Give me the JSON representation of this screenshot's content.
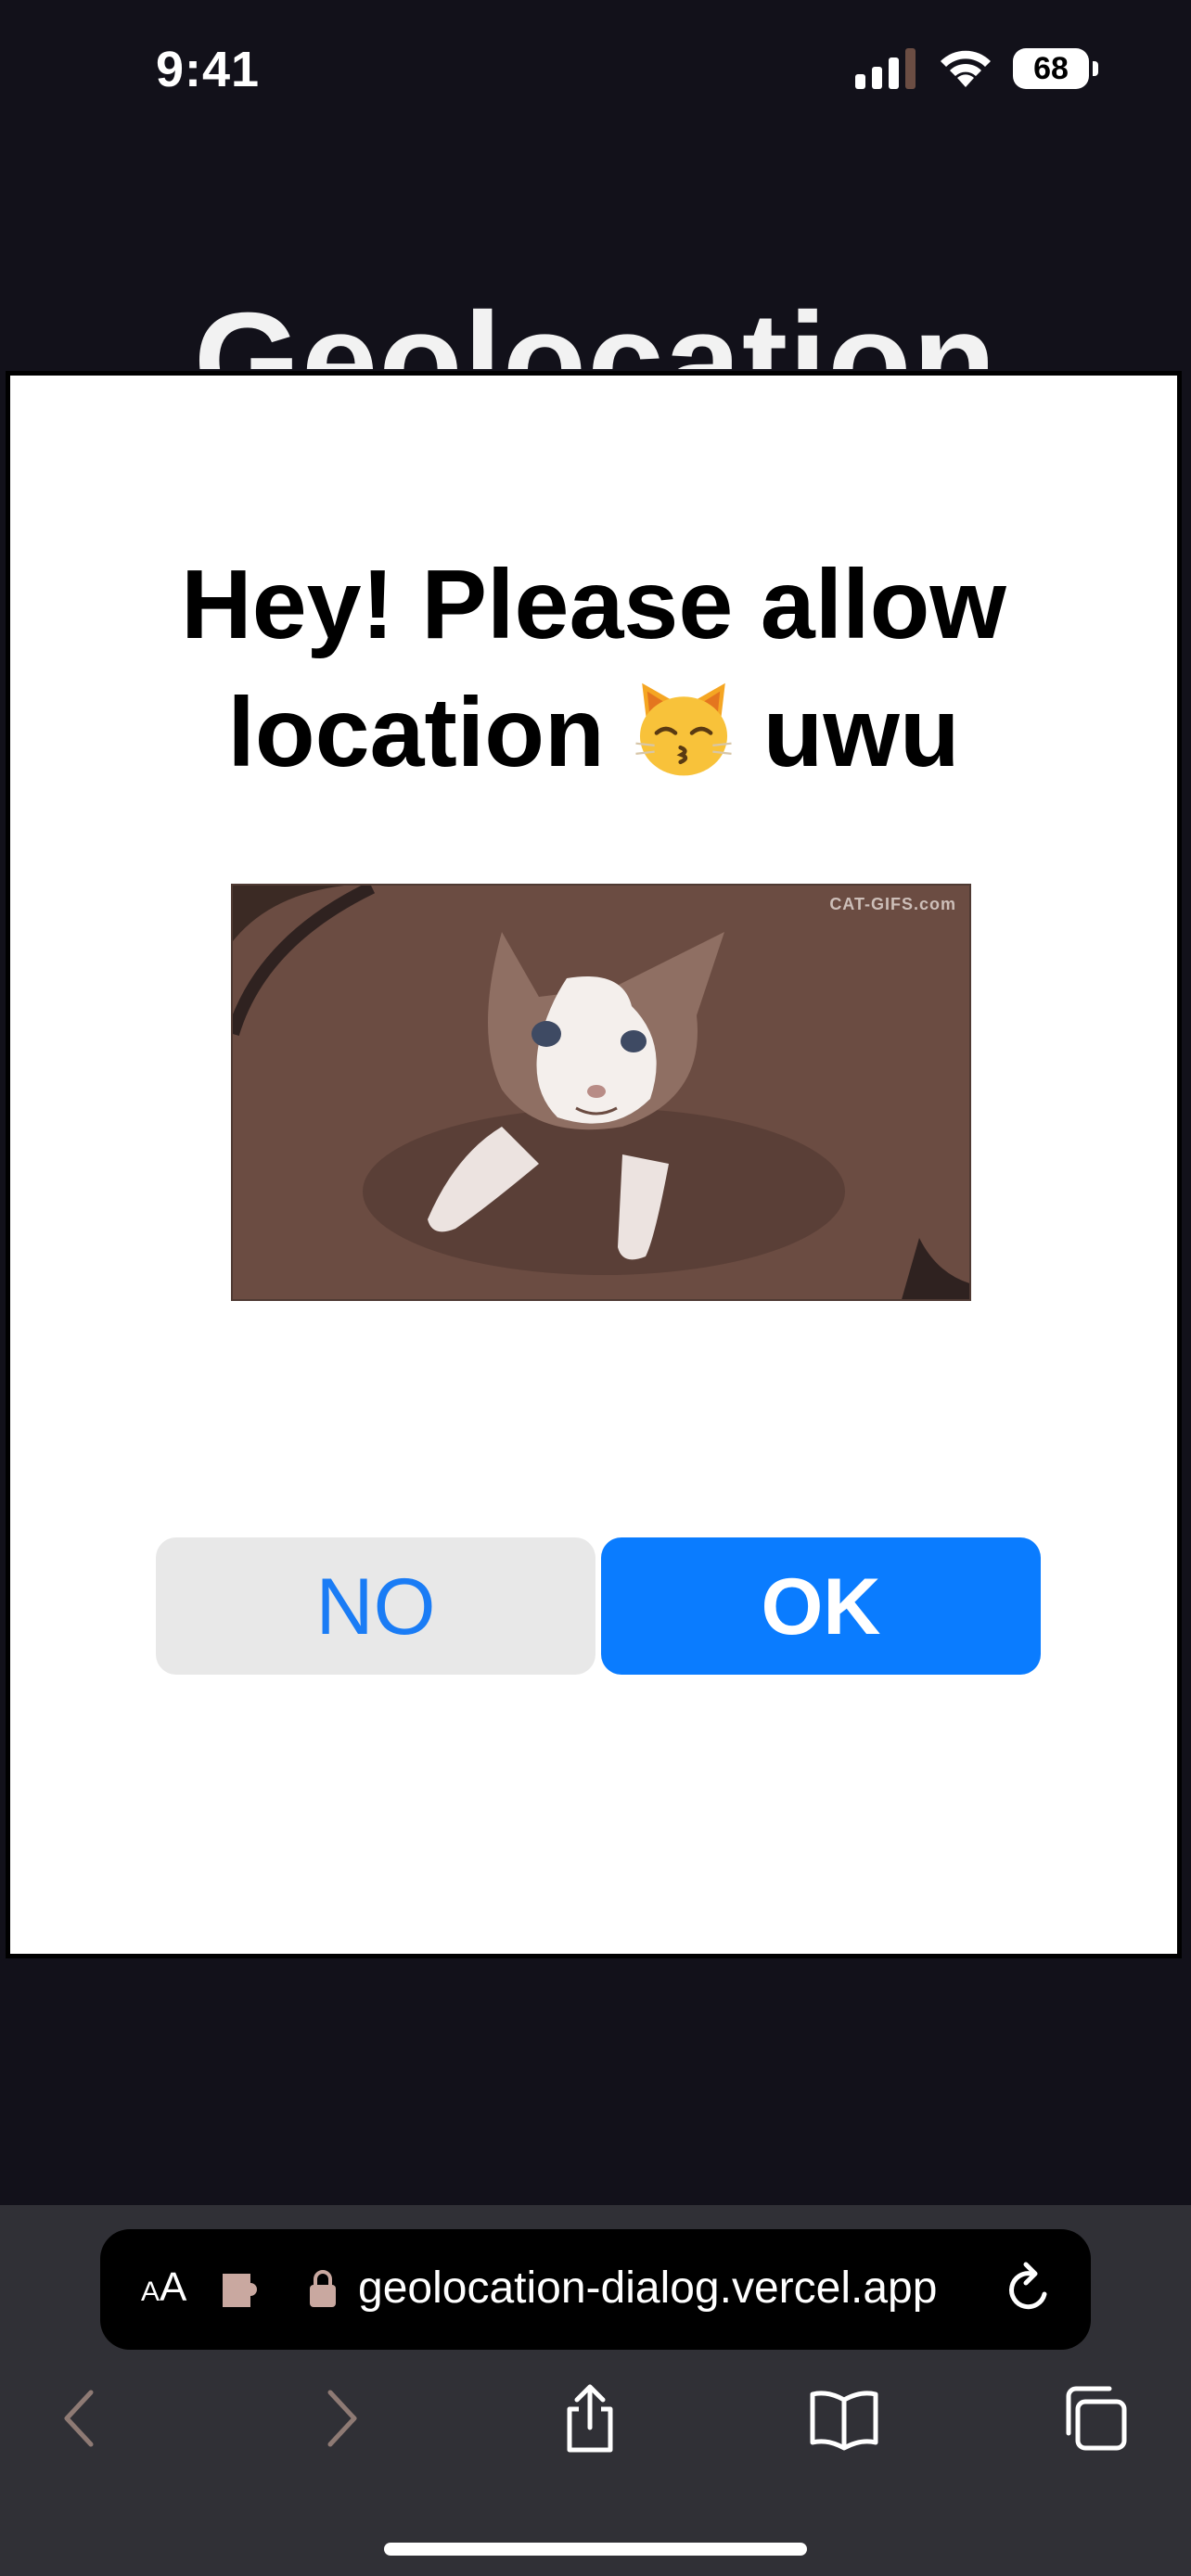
{
  "status_bar": {
    "time": "9:41",
    "battery": "68"
  },
  "background": {
    "heading": "Geolocation"
  },
  "dialog": {
    "title_line1": "Hey! Please allow",
    "title_line2_before": "location",
    "title_line2_after": "uwu",
    "title_emoji": "kissing-cat-emoji",
    "image_watermark": "CAT-GIFS.com",
    "no_label": "NO",
    "ok_label": "OK",
    "colors": {
      "ok_background": "#0a7cff",
      "no_background": "#e8e8e8",
      "no_text": "#1a7cf5"
    }
  },
  "browser": {
    "reader_label_small": "A",
    "reader_label_large": "A",
    "url": "geolocation-dialog.vercel.app",
    "icons": [
      "extension-icon",
      "lock-icon",
      "reload-icon",
      "back-icon",
      "forward-icon",
      "share-icon",
      "bookmarks-icon",
      "tabs-icon"
    ]
  }
}
